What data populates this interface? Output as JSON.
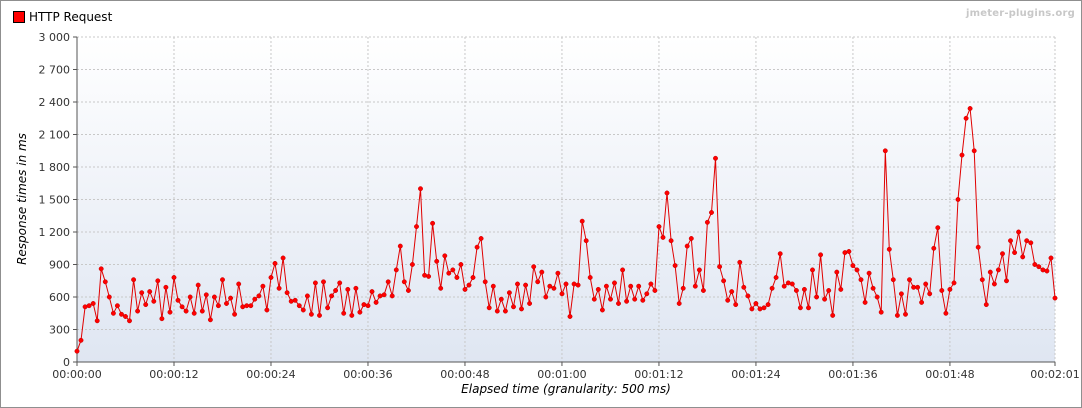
{
  "watermark": "jmeter-plugins.org",
  "colors": {
    "series": "#e00000",
    "marker": "#ff0000",
    "grid": "#c8c8c8"
  },
  "chart_data": {
    "type": "line",
    "xlabel": "Elapsed time (granularity: 500 ms)",
    "ylabel": "Response times in ms",
    "xlim_seconds": [
      0,
      121
    ],
    "ylim": [
      0,
      3000
    ],
    "x_tick_seconds": [
      0,
      12,
      24,
      36,
      48,
      60,
      72,
      84,
      96,
      108,
      121
    ],
    "x_tick_labels": [
      "00:00:00",
      "00:00:12",
      "00:00:24",
      "00:00:36",
      "00:00:48",
      "00:01:00",
      "00:01:12",
      "00:01:24",
      "00:01:36",
      "00:01:48",
      "00:02:01"
    ],
    "y_ticks": [
      0,
      300,
      600,
      900,
      1200,
      1500,
      1800,
      2100,
      2400,
      2700,
      3000
    ],
    "y_tick_labels": [
      "0",
      "300",
      "600",
      "900",
      "1 200",
      "1 500",
      "1 800",
      "2 100",
      "2 400",
      "2 700",
      "3 000"
    ],
    "grid": true,
    "legend_position": "top-left",
    "series": [
      {
        "name": "HTTP Request",
        "x_step_seconds": 0.5,
        "values": [
          100,
          200,
          510,
          520,
          540,
          380,
          860,
          740,
          600,
          450,
          520,
          440,
          420,
          380,
          760,
          470,
          640,
          530,
          650,
          560,
          750,
          400,
          690,
          460,
          780,
          570,
          510,
          470,
          600,
          450,
          710,
          470,
          620,
          390,
          600,
          520,
          760,
          540,
          590,
          440,
          720,
          510,
          520,
          520,
          580,
          610,
          700,
          480,
          780,
          910,
          680,
          960,
          640,
          560,
          570,
          520,
          480,
          610,
          440,
          730,
          430,
          740,
          500,
          610,
          660,
          730,
          450,
          670,
          430,
          680,
          460,
          530,
          520,
          650,
          550,
          610,
          620,
          740,
          610,
          850,
          1070,
          740,
          660,
          900,
          1250,
          1600,
          800,
          790,
          1280,
          930,
          680,
          980,
          820,
          850,
          780,
          900,
          670,
          710,
          780,
          1060,
          1140,
          740,
          500,
          700,
          470,
          580,
          470,
          640,
          510,
          720,
          490,
          710,
          540,
          880,
          740,
          830,
          600,
          700,
          680,
          820,
          630,
          720,
          420,
          720,
          710,
          1300,
          1120,
          780,
          580,
          670,
          480,
          700,
          580,
          730,
          540,
          850,
          560,
          700,
          580,
          700,
          570,
          630,
          720,
          660,
          1250,
          1150,
          1560,
          1120,
          890,
          540,
          680,
          1070,
          1140,
          700,
          850,
          660,
          1290,
          1380,
          1880,
          880,
          750,
          570,
          650,
          530,
          920,
          690,
          610,
          490,
          540,
          490,
          500,
          530,
          680,
          780,
          1000,
          700,
          730,
          720,
          660,
          500,
          670,
          500,
          850,
          600,
          990,
          580,
          660,
          430,
          830,
          670,
          1010,
          1020,
          890,
          850,
          760,
          550,
          820,
          680,
          600,
          460,
          1950,
          1040,
          760,
          430,
          630,
          440,
          760,
          690,
          690,
          550,
          720,
          630,
          1050,
          1240,
          660,
          450,
          670,
          730,
          1500,
          1910,
          2250,
          2340,
          1950,
          1060,
          760,
          530,
          830,
          720,
          850,
          1000,
          750,
          1120,
          1010,
          1200,
          970,
          1120,
          1100,
          900,
          880,
          850,
          840,
          960,
          590
        ]
      }
    ]
  }
}
